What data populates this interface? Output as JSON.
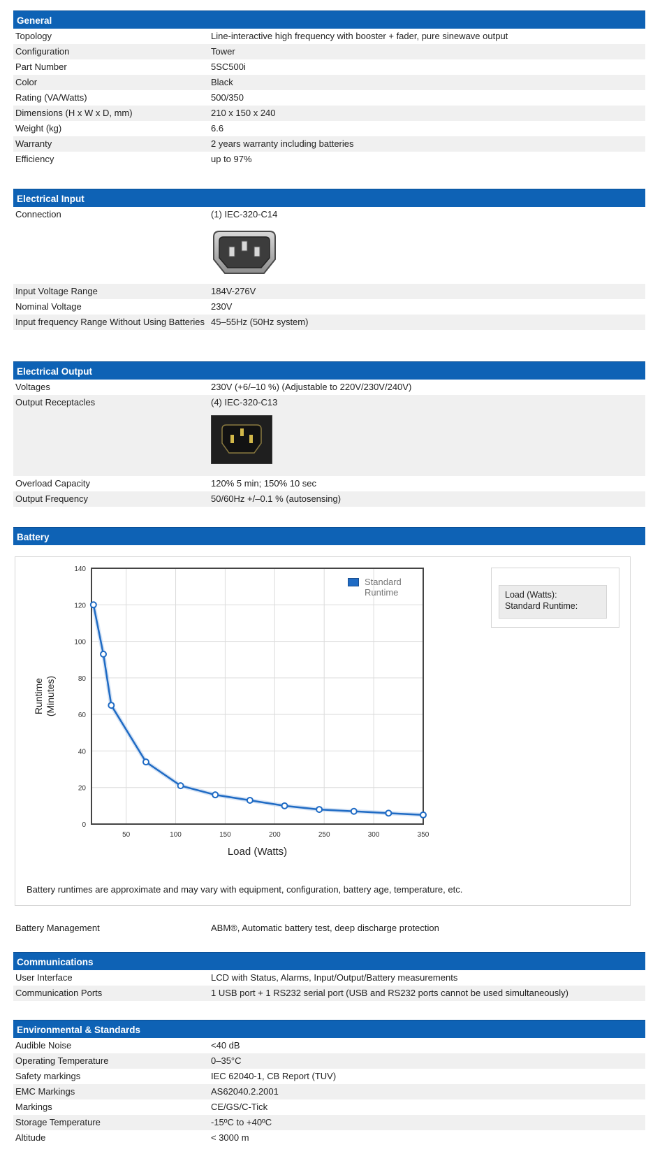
{
  "general": {
    "title": "General",
    "rows": [
      {
        "label": "Topology",
        "value": "Line-interactive high frequency with booster + fader, pure sinewave output"
      },
      {
        "label": "Configuration",
        "value": "Tower"
      },
      {
        "label": "Part Number",
        "value": "5SC500i"
      },
      {
        "label": "Color",
        "value": "Black"
      },
      {
        "label": "Rating (VA/Watts)",
        "value": "500/350"
      },
      {
        "label": "Dimensions (H x W x D, mm)",
        "value": "210 x 150 x 240"
      },
      {
        "label": "Weight (kg)",
        "value": "6.6"
      },
      {
        "label": "Warranty",
        "value": "2 years warranty including batteries"
      },
      {
        "label": "Efficiency",
        "value": "up to 97%"
      }
    ]
  },
  "electrical_input": {
    "title": "Electrical Input",
    "connection_label": "Connection",
    "connection_value": "(1) IEC-320-C14",
    "rows": [
      {
        "label": "Input Voltage Range",
        "value": "184V-276V"
      },
      {
        "label": "Nominal Voltage",
        "value": "230V"
      },
      {
        "label": "Input frequency Range Without Using Batteries",
        "value": "45–55Hz (50Hz system)"
      }
    ]
  },
  "electrical_output": {
    "title": "Electrical Output",
    "voltages_label": "Voltages",
    "voltages_value": "230V (+6/–10 %) (Adjustable to 220V/230V/240V)",
    "receptacles_label": "Output Receptacles",
    "receptacles_value": "(4) IEC-320-C13",
    "rows": [
      {
        "label": "Overload Capacity",
        "value": "120% 5 min; 150% 10 sec"
      },
      {
        "label": "Output Frequency",
        "value": "50/60Hz +/–0.1 % (autosensing)"
      }
    ]
  },
  "battery": {
    "title": "Battery",
    "note": "Battery runtimes are approximate and may vary with equipment, configuration, battery age, temperature, etc.",
    "tooltip_load": "Load (Watts):",
    "tooltip_runtime": "Standard Runtime:",
    "management_label": "Battery Management",
    "management_value": "ABM®, Automatic battery test, deep discharge protection"
  },
  "chart_data": {
    "type": "line",
    "xlabel": "Load (Watts)",
    "ylabel_line1": "Runtime",
    "ylabel_line2": "(Minutes)",
    "xlim": [
      15,
      350
    ],
    "ylim": [
      0,
      140
    ],
    "xticks": [
      50,
      100,
      150,
      200,
      250,
      300,
      350
    ],
    "yticks": [
      0,
      20,
      40,
      60,
      80,
      100,
      120,
      140
    ],
    "grid": true,
    "legend_position": "top-right",
    "series": [
      {
        "name": "Standard Runtime",
        "color": "#1f6bc4",
        "x": [
          17,
          27,
          35,
          70,
          105,
          140,
          175,
          210,
          245,
          280,
          315,
          350
        ],
        "y": [
          120,
          93,
          65,
          34,
          21,
          16,
          13,
          10,
          8,
          7,
          6,
          5
        ]
      }
    ]
  },
  "communications": {
    "title": "Communications",
    "rows": [
      {
        "label": "User Interface",
        "value": "LCD with Status, Alarms, Input/Output/Battery measurements"
      },
      {
        "label": "Communication Ports",
        "value": "1 USB port + 1 RS232 serial port (USB and RS232 ports cannot be used simultaneously)"
      }
    ]
  },
  "environmental": {
    "title": "Environmental & Standards",
    "rows": [
      {
        "label": "Audible Noise",
        "value": "<40 dB"
      },
      {
        "label": "Operating Temperature",
        "value": "0–35°C"
      },
      {
        "label": "Safety markings",
        "value": "IEC 62040-1, CB Report (TUV)"
      },
      {
        "label": "EMC Markings",
        "value": "AS62040.2.2001"
      },
      {
        "label": "Markings",
        "value": "CE/GS/C-Tick"
      },
      {
        "label": "Storage Temperature",
        "value": "-15ºC to +40ºC"
      },
      {
        "label": "Altitude",
        "value": "< 3000 m"
      }
    ]
  }
}
